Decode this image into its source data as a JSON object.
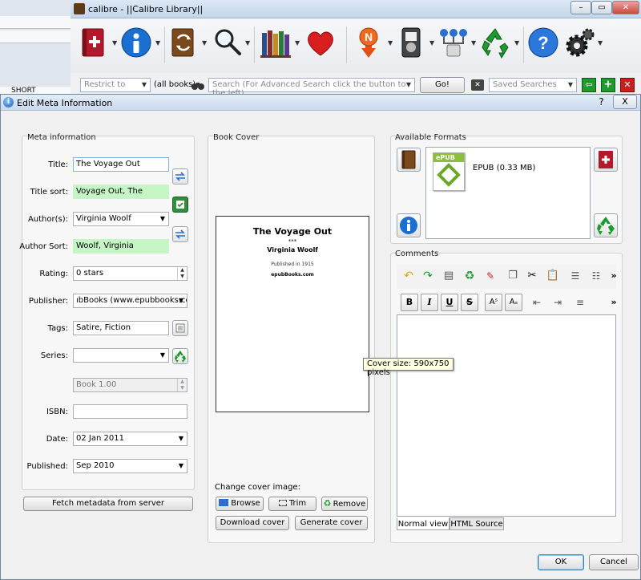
{
  "main_window": {
    "title": "calibre - ||Calibre Library||",
    "toolbar": {
      "icons": [
        "add-books-icon",
        "edit-metadata-icon",
        "convert-books-icon",
        "view-icon",
        "library-icon",
        "donate-icon",
        "news-icon",
        "device-icon",
        "connect-share-icon",
        "remove-books-icon",
        "help-icon",
        "preferences-icon"
      ]
    },
    "search": {
      "restrict_placeholder": "Restrict to",
      "all_books": "(all books)",
      "placeholder": "Search (For Advanced Search click the button to the left)",
      "go_label": "Go!",
      "saved_searches_placeholder": "Saved Searches"
    },
    "background_label": "SHORT"
  },
  "dialog": {
    "title": "Edit Meta Information",
    "help_label": "?",
    "close_label": "X",
    "meta_group_title": "Meta information",
    "fields": {
      "title_label": "Title:",
      "title_value": "The Voyage Out",
      "title_sort_label": "Title sort:",
      "title_sort_value": "Voyage Out, The",
      "authors_label": "Author(s):",
      "authors_value": "Virginia Woolf",
      "author_sort_label": "Author Sort:",
      "author_sort_value": "Woolf, Virginia",
      "rating_label": "Rating:",
      "rating_value": "0 stars",
      "publisher_label": "Publisher:",
      "publisher_value": "ıbBooks (www.epubbooks.com)",
      "tags_label": "Tags:",
      "tags_value": "Satire, Fiction",
      "series_label": "Series:",
      "series_value": "",
      "series_index_value": "Book 1.00",
      "isbn_label": "ISBN:",
      "isbn_value": "",
      "date_label": "Date:",
      "date_value": "02 Jan 2011",
      "published_label": "Published:",
      "published_value": "Sep 2010"
    },
    "fetch_button": "Fetch metadata from server",
    "cover": {
      "group_title": "Book Cover",
      "page_title": "The Voyage Out",
      "page_sep": "***",
      "page_author": "Virginia Woolf",
      "page_published": "Published in 1915",
      "page_source": "epubBooks.com",
      "change_label": "Change cover image:",
      "browse_label": "Browse",
      "trim_label": "Trim",
      "remove_label": "Remove",
      "download_label": "Download cover",
      "generate_label": "Generate cover"
    },
    "formats": {
      "group_title": "Available Formats",
      "items": [
        {
          "badge": "ePUB",
          "label": "EPUB (0.33 MB)"
        }
      ]
    },
    "comments": {
      "group_title": "Comments",
      "bold": "B",
      "italic": "I",
      "underline": "U",
      "strike": "S",
      "more": "»",
      "tab_normal": "Normal view",
      "tab_html": "HTML Source"
    },
    "tooltip": "Cover size: 590x750 pixels",
    "ok_label": "OK",
    "cancel_label": "Cancel"
  }
}
